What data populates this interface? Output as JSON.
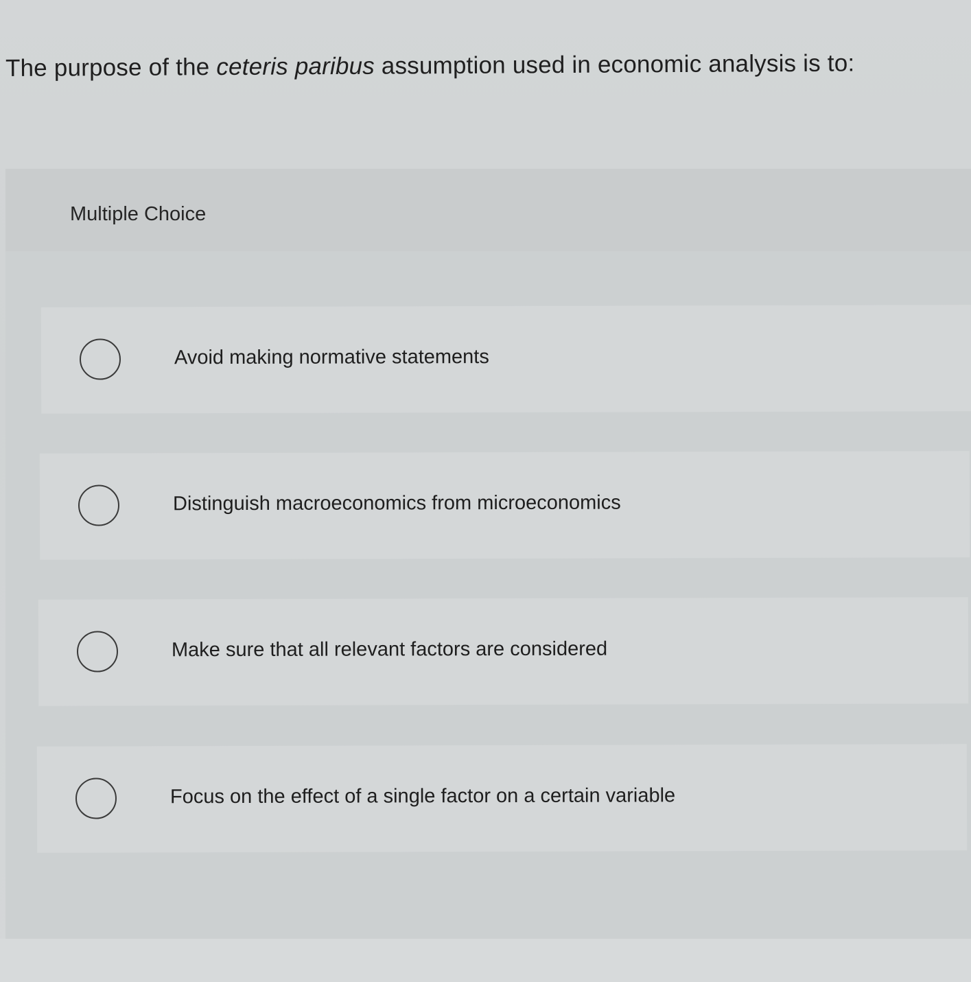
{
  "question": {
    "prefix": "The purpose of the ",
    "emphasis": "ceteris paribus",
    "suffix": " assumption used in economic analysis is to:"
  },
  "section_label": "Multiple Choice",
  "options": [
    {
      "label": "Avoid making normative statements",
      "selected": false
    },
    {
      "label": "Distinguish macroeconomics from microeconomics",
      "selected": false
    },
    {
      "label": "Make sure that all relevant factors are considered",
      "selected": false
    },
    {
      "label": "Focus on the effect of a single factor on a certain variable",
      "selected": false
    }
  ]
}
